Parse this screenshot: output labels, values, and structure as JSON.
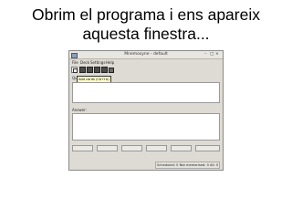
{
  "slide": {
    "title_line1": "Obrim el programa i ens apareix",
    "title_line2": "aquesta finestra..."
  },
  "window": {
    "title": "Mnemosyne - default",
    "controls": [
      "–",
      "□",
      "×"
    ]
  },
  "menu": {
    "file": "File",
    "deck": "Deck",
    "settings": "Settings",
    "help": "Help"
  },
  "toolbar": {
    "buttons": [
      "add-cards",
      "edit-card",
      "delete-card",
      "edit-deck",
      "statistics",
      "mnemosyne"
    ]
  },
  "tooltip": "Add cards (Ctrl+A)",
  "question_label": "Qu",
  "answer_label": "Answer:",
  "grade_buttons_count": 6,
  "status": {
    "text": "Scheduled: 0  Not memorised: 0  All: 0"
  }
}
